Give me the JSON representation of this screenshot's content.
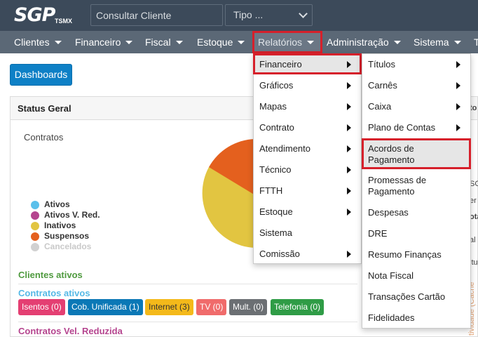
{
  "brand": {
    "logo_main": "SGP",
    "logo_sub": "TSMX"
  },
  "search": {
    "placeholder": "Consultar Cliente"
  },
  "type_select": {
    "value": "Tipo ..."
  },
  "nav": {
    "items": [
      "Clientes",
      "Financeiro",
      "Fiscal",
      "Estoque",
      "Relatórios",
      "Administração",
      "Sistema",
      "T"
    ]
  },
  "dashboards_label": "Dashboards",
  "panel": {
    "title": "Status Geral",
    "chart_label": "Contratos",
    "legend": [
      {
        "label": "Ativos",
        "color": "#5bc0eb"
      },
      {
        "label": "Ativos V. Red.",
        "color": "#b5458f"
      },
      {
        "label": "Inativos",
        "color": "#e2c541"
      },
      {
        "label": "Suspensos",
        "color": "#e4601e"
      },
      {
        "label": "Cancelados",
        "color": "#d1d1d1"
      }
    ]
  },
  "sections": {
    "clientes_ativos": "Clientes ativos",
    "contratos_ativos": "Contratos ativos",
    "contratos_vel_reduzida": "Contratos Vel. Reduzida"
  },
  "badges": [
    {
      "label": "Isentos (0)",
      "color": "#e43f72"
    },
    {
      "label": "Cob. Unificada (1)",
      "color": "#0b78b6"
    },
    {
      "label": "Internet (3)",
      "color": "#f4b91a"
    },
    {
      "label": "TV (0)",
      "color": "#f06b6b"
    },
    {
      "label": "Mult. (0)",
      "color": "#6b6f73"
    },
    {
      "label": "Telefonia (0)",
      "color": "#2f9c46"
    }
  ],
  "menu_relatorios": {
    "items": [
      {
        "label": "Financeiro",
        "submenu": true
      },
      {
        "label": "Gráficos",
        "submenu": true
      },
      {
        "label": "Mapas",
        "submenu": true
      },
      {
        "label": "Contrato",
        "submenu": true
      },
      {
        "label": "Atendimento",
        "submenu": true
      },
      {
        "label": "Técnico",
        "submenu": true
      },
      {
        "label": "FTTH",
        "submenu": true
      },
      {
        "label": "Estoque",
        "submenu": true
      },
      {
        "label": "Sistema",
        "submenu": false
      },
      {
        "label": "Comissão",
        "submenu": true
      }
    ]
  },
  "menu_financeiro": {
    "items": [
      {
        "label": "Títulos",
        "submenu": true
      },
      {
        "label": "Carnês",
        "submenu": true
      },
      {
        "label": "Caixa",
        "submenu": true
      },
      {
        "label": "Plano de Contas",
        "submenu": true
      },
      {
        "label": "Acordos de Pagamento",
        "line1": "Acordos de",
        "line2": "Pagamento",
        "submenu": false
      },
      {
        "label": "Promessas de Pagamento",
        "line1": "Promessas de",
        "line2": "Pagamento",
        "submenu": false
      },
      {
        "label": "Despesas",
        "submenu": false
      },
      {
        "label": "DRE",
        "submenu": false
      },
      {
        "label": "Resumo Finanças",
        "submenu": false
      },
      {
        "label": "Nota Fiscal",
        "submenu": false
      },
      {
        "label": "Transações Cartão",
        "submenu": false
      },
      {
        "label": "Fidelidades",
        "submenu": false
      }
    ]
  },
  "right_fragments": [
    "to",
    "SC",
    "er",
    "ota",
    "al",
    "itu"
  ],
  "vertical_fragment": "tividade (Cache",
  "colors": {
    "topbar": "#3c4a5a",
    "navbar": "#5b6876",
    "highlight_box": "#d6202b",
    "primary_button": "#0e80c6"
  },
  "icons": {
    "caret": "caret-down-icon",
    "submenu_arrow": "chevron-right-icon",
    "select_chevron": "chevron-down-icon"
  }
}
